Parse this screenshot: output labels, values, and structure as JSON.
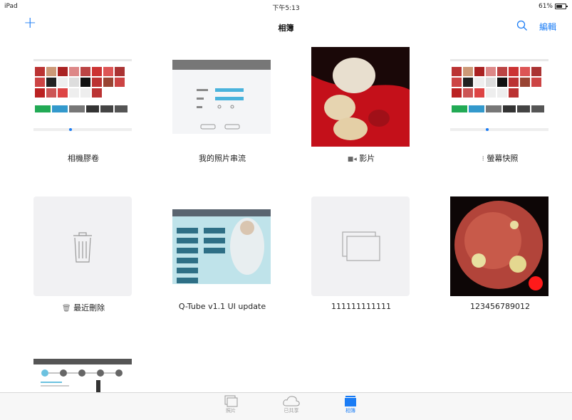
{
  "status": {
    "device": "iPad",
    "time": "下午5:13",
    "battery": "61%"
  },
  "nav": {
    "add_label": "+",
    "title": "相簿",
    "edit_label": "編輯"
  },
  "albums": [
    {
      "label": "相機膠卷"
    },
    {
      "label": "我的照片串流"
    },
    {
      "label": "影片"
    },
    {
      "label": "螢幕快照"
    },
    {
      "label": "最近刪除"
    },
    {
      "label": "Q-Tube v1.1 UI update"
    },
    {
      "label": "111111111111"
    },
    {
      "label": "123456789012"
    },
    {
      "label": ""
    }
  ],
  "tabs": [
    {
      "label": "照片"
    },
    {
      "label": "已共享"
    },
    {
      "label": "相簿"
    }
  ],
  "colors": {
    "accent": "#1a7cf5",
    "gum": "#d4202a"
  },
  "selected_tab": "相簿"
}
